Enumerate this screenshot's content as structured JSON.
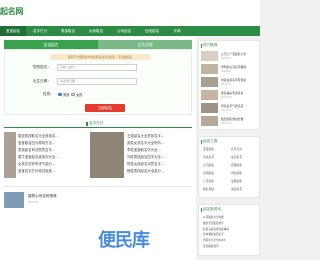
{
  "site": {
    "logo": "起名网"
  },
  "nav": [
    "宝宝起名",
    "名字打分",
    "男孩取名",
    "女孩取名",
    "公司起名",
    "在线起名",
    "字典"
  ],
  "tabs": [
    "宝宝起名",
    "吉名文档"
  ],
  "form": {
    "hint": "遇有不方便起名时欢迎联系此平台起名，专业做起名",
    "surname_label": "您的姓氏：",
    "surname_placeholder": "请输入姓氏",
    "birth_label": "出生日期：",
    "birth_placeholder": "请选择日期",
    "gender_label": "性别：",
    "gender_options": [
      "男孩",
      "女孩"
    ],
    "submit": "立即起名"
  },
  "section": {
    "title": "名字打分"
  },
  "list_left": [
    "属鼠男孩取名大全常用名...",
    "宝宝取名四大原则方法...",
    "男孩起名有诗意的名字...",
    "属牛宝宝起名宜用字大全...",
    "女孩名字好听洋气高分...",
    "宝宝名字打分测试免费..."
  ],
  "list_right": [
    "王姓起名大全男孩名字...",
    "张姓女孩名字大全好听...",
    "李姓宝宝取名字大全...",
    "刘姓男孩起名四字大全...",
    "陈姓女孩起名诗意名字...",
    "杨姓男孩起名大全高分..."
  ],
  "bottom_item": {
    "title": "建筑公司名称推荐",
    "date": "2024-01"
  },
  "sidebar": {
    "hot_title": "热门推荐",
    "hot_items": [
      {
        "text": "公司二个字起名大全",
        "date": "2023-11"
      },
      {
        "text": "吉利的公司名字推荐",
        "date": "2023-10"
      },
      {
        "text": "男孩女孩名字有寓意",
        "date": "2023-10"
      },
      {
        "text": "寓意美好有诗意名",
        "date": "2023-09"
      },
      {
        "text": "男孩名字气质高贵",
        "date": "2023-09"
      },
      {
        "text": "姓氏起名测试分数",
        "date": "2023-08"
      }
    ],
    "tools_title": "起名工具",
    "tools": [
      [
        "宝宝起名",
        "名字打分"
      ],
      [
        "男孩名字",
        "女孩名字"
      ],
      [
        "公司起名",
        "店铺起名"
      ],
      [
        "诗词起名",
        "周易起名"
      ],
      [
        "八字起名",
        "生辰起名"
      ],
      [
        "姓名测试",
        "英文名字"
      ]
    ],
    "news_title": "起名新资讯",
    "news": [
      "公司取名大全免费",
      "属虎宝宝起名用字",
      "给孩子起名的注意事项",
      "有内涵的女孩名字",
      "男孩名字大全2024",
      "宝宝取名技巧"
    ]
  },
  "watermark": "便民库"
}
